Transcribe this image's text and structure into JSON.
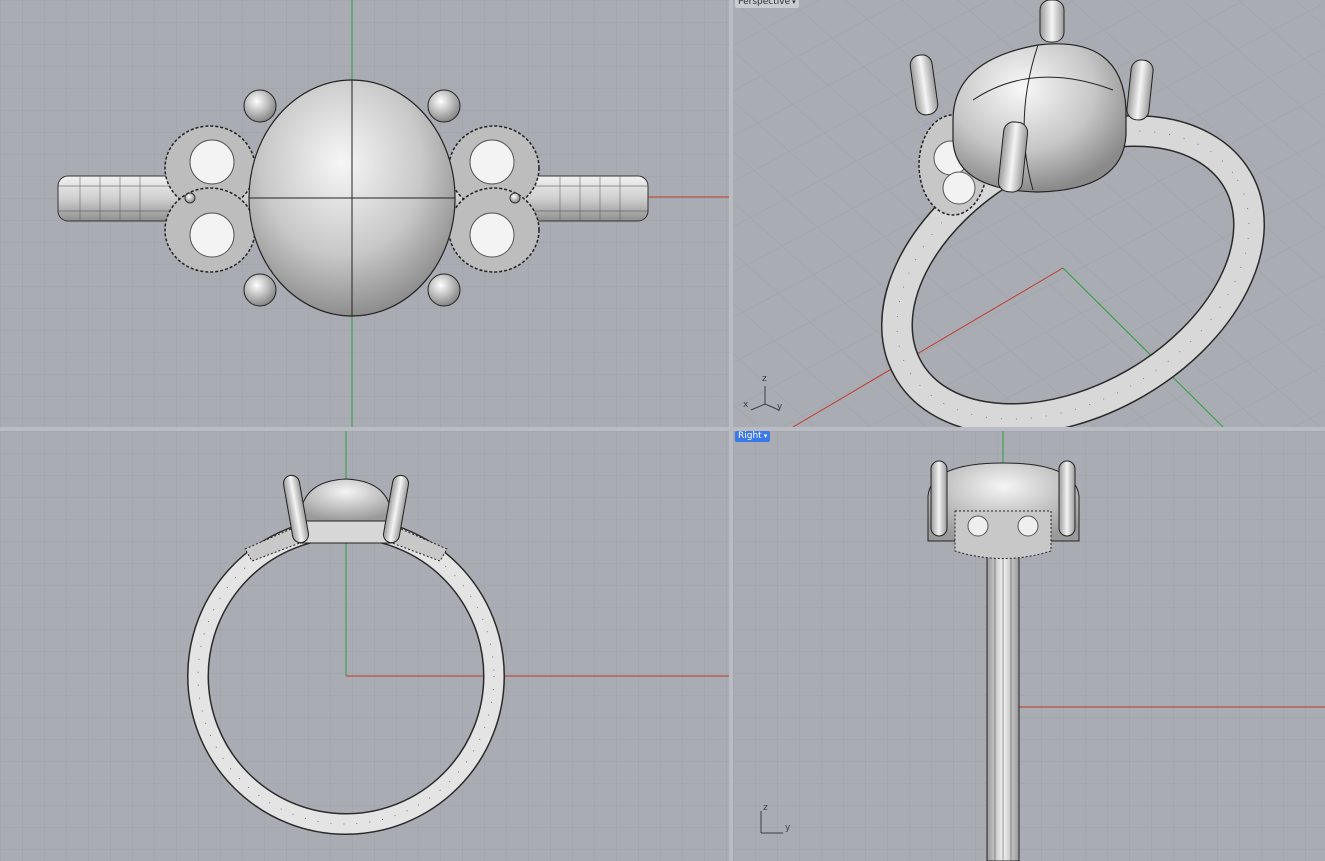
{
  "viewports": {
    "top": {
      "label": ""
    },
    "perspective": {
      "label": "Perspective",
      "dropdown": "▾"
    },
    "front": {
      "label": ""
    },
    "right": {
      "label": "Right",
      "dropdown": "▾"
    }
  },
  "gizmo": {
    "perspective": {
      "z": "z",
      "x": "x",
      "y": "y"
    },
    "right": {
      "z": "z",
      "y": "y"
    }
  },
  "colors": {
    "viewport_bg": "#a9adb3",
    "grid_minor": "#9ea2a8",
    "grid_major": "#8f9399",
    "x_axis": "#c0392b",
    "y_axis": "#2e9e3e",
    "active_tab": "#3b79e6",
    "metal": "#d9d9d9"
  },
  "icons": {
    "dropdown": "chevron-down-icon",
    "gizmo": "axes-gizmo-icon"
  }
}
